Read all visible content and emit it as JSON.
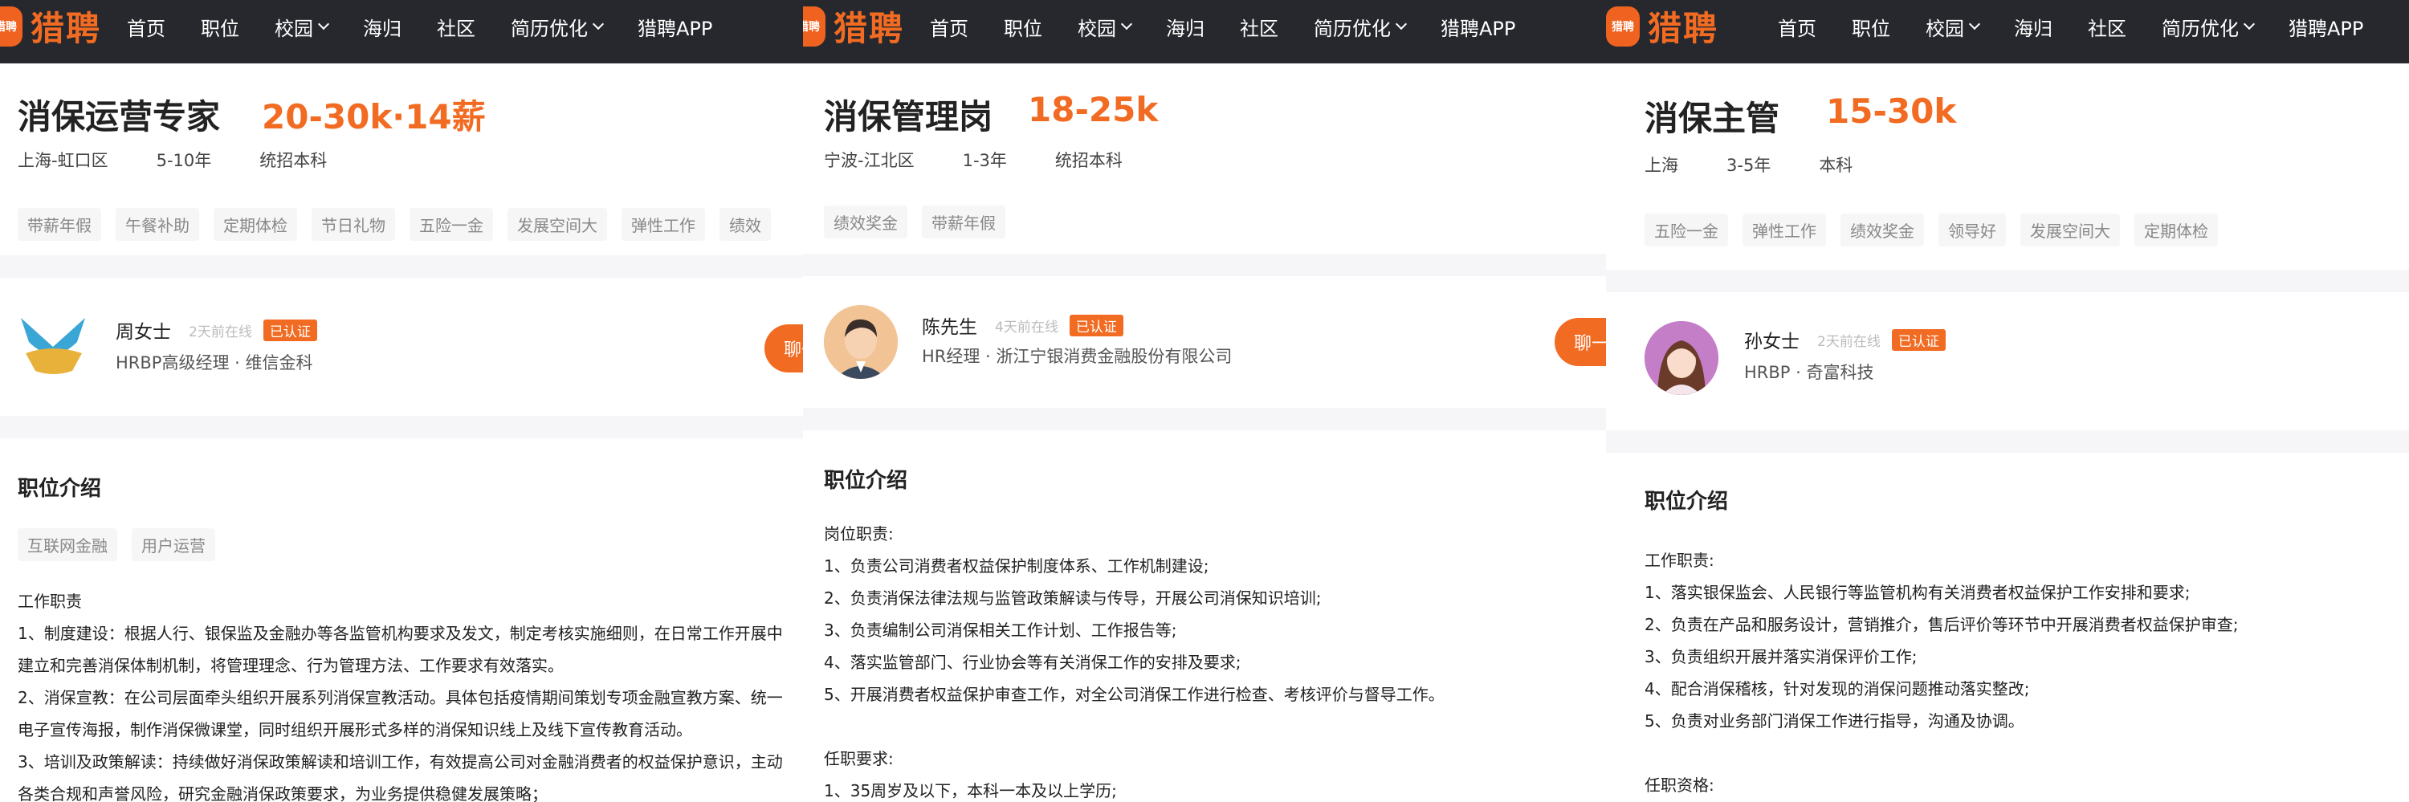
{
  "brand": {
    "logo_badge": "猎聘",
    "logo_text": "猎聘"
  },
  "nav": [
    "首页",
    "职位",
    "校园",
    "海归",
    "社区",
    "简历优化",
    "猎聘APP"
  ],
  "panels": [
    {
      "title": "消保运营专家",
      "salary": "20-30k·14薪",
      "meta": [
        "上海-虹口区",
        "5-10年",
        "统招本科"
      ],
      "tags": [
        "带薪年假",
        "午餐补助",
        "定期体检",
        "节日礼物",
        "五险一金",
        "发展空间大",
        "弹性工作",
        "绩效"
      ],
      "recruiter": {
        "name": "周女士",
        "online": "2天前在线",
        "verified": "已认证",
        "role": "HRBP高级经理 · 维信金科"
      },
      "chat": "聊一",
      "section_title": "职位介绍",
      "section_tags": [
        "互联网金融",
        "用户运营"
      ],
      "lines": [
        "工作职责",
        "1、制度建设：根据人行、银保监及金融办等各监管机构要求及发文，制定考核实施细则，在日常工作开展中",
        "建立和完善消保体制机制，将管理理念、行为管理方法、工作要求有效落实。",
        "2、消保宣教：在公司层面牵头组织开展系列消保宣教活动。具体包括疫情期间策划专项金融宣教方案、统一",
        "电子宣传海报，制作消保微课堂，同时组织开展形式多样的消保知识线上及线下宣传教育活动。",
        "3、培训及政策解读：持续做好消保政策解读和培训工作，有效提高公司对金融消费者的权益保护意识，主动",
        "各类合规和声誉风险，研究金融消保政策要求，为业务提供稳健发展策略；"
      ]
    },
    {
      "title": "消保管理岗",
      "salary": "18-25k",
      "meta": [
        "宁波-江北区",
        "1-3年",
        "统招本科"
      ],
      "tags": [
        "绩效奖金",
        "带薪年假"
      ],
      "recruiter": {
        "name": "陈先生",
        "online": "4天前在线",
        "verified": "已认证",
        "role": "HR经理 · 浙江宁银消费金融股份有限公司"
      },
      "chat": "聊一",
      "section_title": "职位介绍",
      "lines": [
        "岗位职责:",
        "1、负责公司消费者权益保护制度体系、工作机制建设;",
        "2、负责消保法律法规与监管政策解读与传导，开展公司消保知识培训;",
        "3、负责编制公司消保相关工作计划、工作报告等;",
        "4、落实监管部门、行业协会等有关消保工作的安排及要求;",
        "5、开展消费者权益保护审查工作，对全公司消保工作进行检查、考核评价与督导工作。",
        "",
        "任职要求:",
        "1、35周岁及以下，本科一本及以上学历;"
      ]
    },
    {
      "title": "消保主管",
      "salary": "15-30k",
      "meta": [
        "上海",
        "3-5年",
        "本科"
      ],
      "tags": [
        "五险一金",
        "弹性工作",
        "绩效奖金",
        "领导好",
        "发展空间大",
        "定期体检"
      ],
      "recruiter": {
        "name": "孙女士",
        "online": "2天前在线",
        "verified": "已认证",
        "role": "HRBP · 奇富科技"
      },
      "section_title": "职位介绍",
      "lines": [
        "工作职责:",
        "1、落实银保监会、人民银行等监管机构有关消费者权益保护工作安排和要求;",
        "2、负责在产品和服务设计，营销推介，售后评价等环节中开展消费者权益保护审查;",
        "3、负责组织开展并落实消保评价工作;",
        "4、配合消保稽核，针对发现的消保问题推动落实整改;",
        "5、负责对业务部门消保工作进行指导，沟通及协调。",
        "",
        "任职资格:"
      ]
    }
  ],
  "colors": {
    "accent": "#f26b22",
    "topbar": "#26282e",
    "tag_bg": "#f6f6f6"
  },
  "icons": {
    "chevron": "chevron-down-icon",
    "logo": "liepin-logo-icon"
  }
}
